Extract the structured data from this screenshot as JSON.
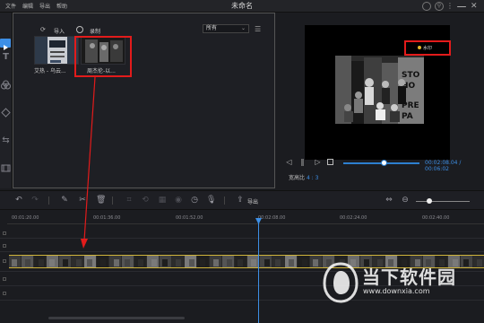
{
  "window": {
    "title": "未命名",
    "menu": [
      "文件",
      "编辑",
      "导出",
      "帮助"
    ]
  },
  "library": {
    "import_label": "导入",
    "record_label": "录制",
    "filter_value": "所有",
    "items": [
      {
        "label": "艾热 - 乌云..."
      },
      {
        "label": "周杰伦-以..."
      }
    ]
  },
  "preview": {
    "watermark_text": "水印",
    "time": "00:02:08.04 / 00:06:02",
    "aspect_label": "宽高比",
    "aspect_value": "4 : 3",
    "progress": 0.53
  },
  "toolbar": {
    "export_label": "导出",
    "zoom_level": 0.25
  },
  "timeline": {
    "ticks": [
      "00:01:20.00",
      "00:01:36.00",
      "00:01:52.00",
      "00:02:08.00",
      "00:02:24.00",
      "00:02:40.00"
    ],
    "playhead_time": "00:02:08.00"
  },
  "brand": {
    "name": "当下软件园",
    "url": "www.downxia.com"
  },
  "colors": {
    "accent": "#3d8fe6",
    "highlight": "#e21b1b",
    "clip_border": "#cfb43a",
    "background": "#1b1c20"
  }
}
